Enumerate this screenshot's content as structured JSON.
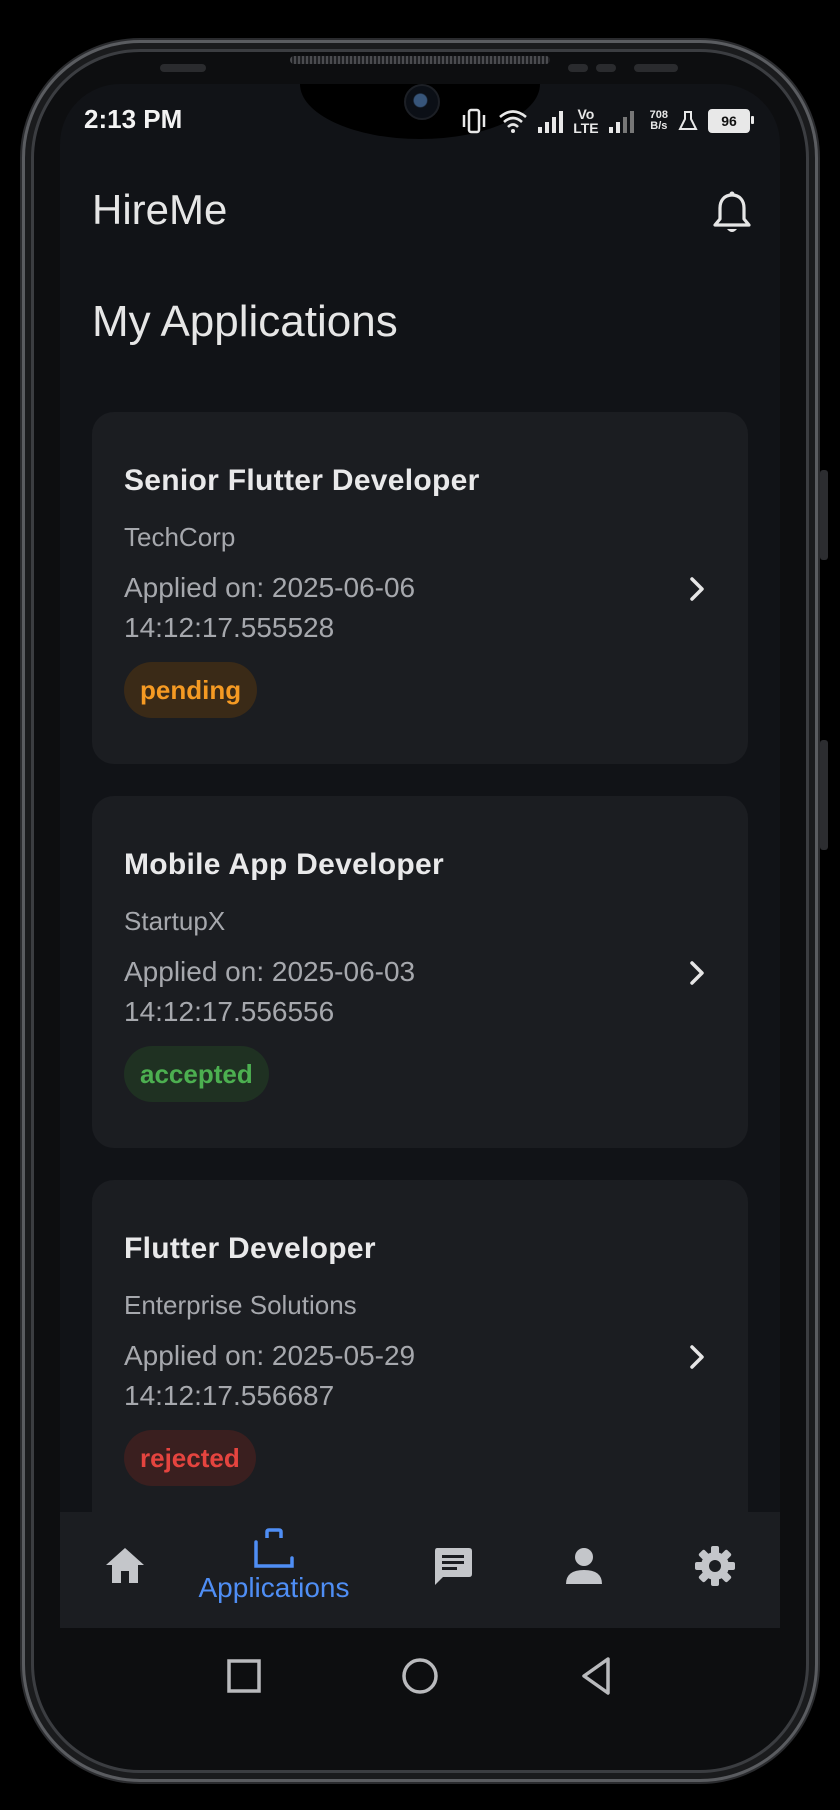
{
  "status_bar": {
    "time": "2:13 PM",
    "net_speed_value": "708",
    "net_speed_unit": "B/s",
    "volte_top": "Vo",
    "volte_bottom": "LTE",
    "battery": "96",
    "icons": [
      "vibrate-icon",
      "wifi-icon",
      "signal-icon",
      "volte-icon",
      "signal-icon",
      "lab-icon",
      "battery-icon"
    ]
  },
  "header": {
    "app_name": "HireMe",
    "notification_icon": "bell-icon"
  },
  "page": {
    "title": "My Applications"
  },
  "applications": [
    {
      "title": "Senior Flutter Developer",
      "company": "TechCorp",
      "applied_on": "Applied on: 2025-06-06 14:12:17.555528",
      "status": "pending"
    },
    {
      "title": "Mobile App Developer",
      "company": "StartupX",
      "applied_on": "Applied on: 2025-06-03 14:12:17.556556",
      "status": "accepted"
    },
    {
      "title": "Flutter Developer",
      "company": "Enterprise Solutions",
      "applied_on": "Applied on: 2025-05-29 14:12:17.556687",
      "status": "rejected"
    }
  ],
  "bottom_nav": {
    "items": [
      {
        "icon": "home-icon",
        "label": ""
      },
      {
        "icon": "briefcase-icon",
        "label": "Applications",
        "active": true
      },
      {
        "icon": "chat-icon",
        "label": ""
      },
      {
        "icon": "person-icon",
        "label": ""
      },
      {
        "icon": "gear-icon",
        "label": ""
      }
    ]
  },
  "colors": {
    "background": "#111317",
    "card": "#1b1d21",
    "accent": "#4f8ef5",
    "pending": "#f59a23",
    "accepted": "#4caf50",
    "rejected": "#e5443f"
  }
}
